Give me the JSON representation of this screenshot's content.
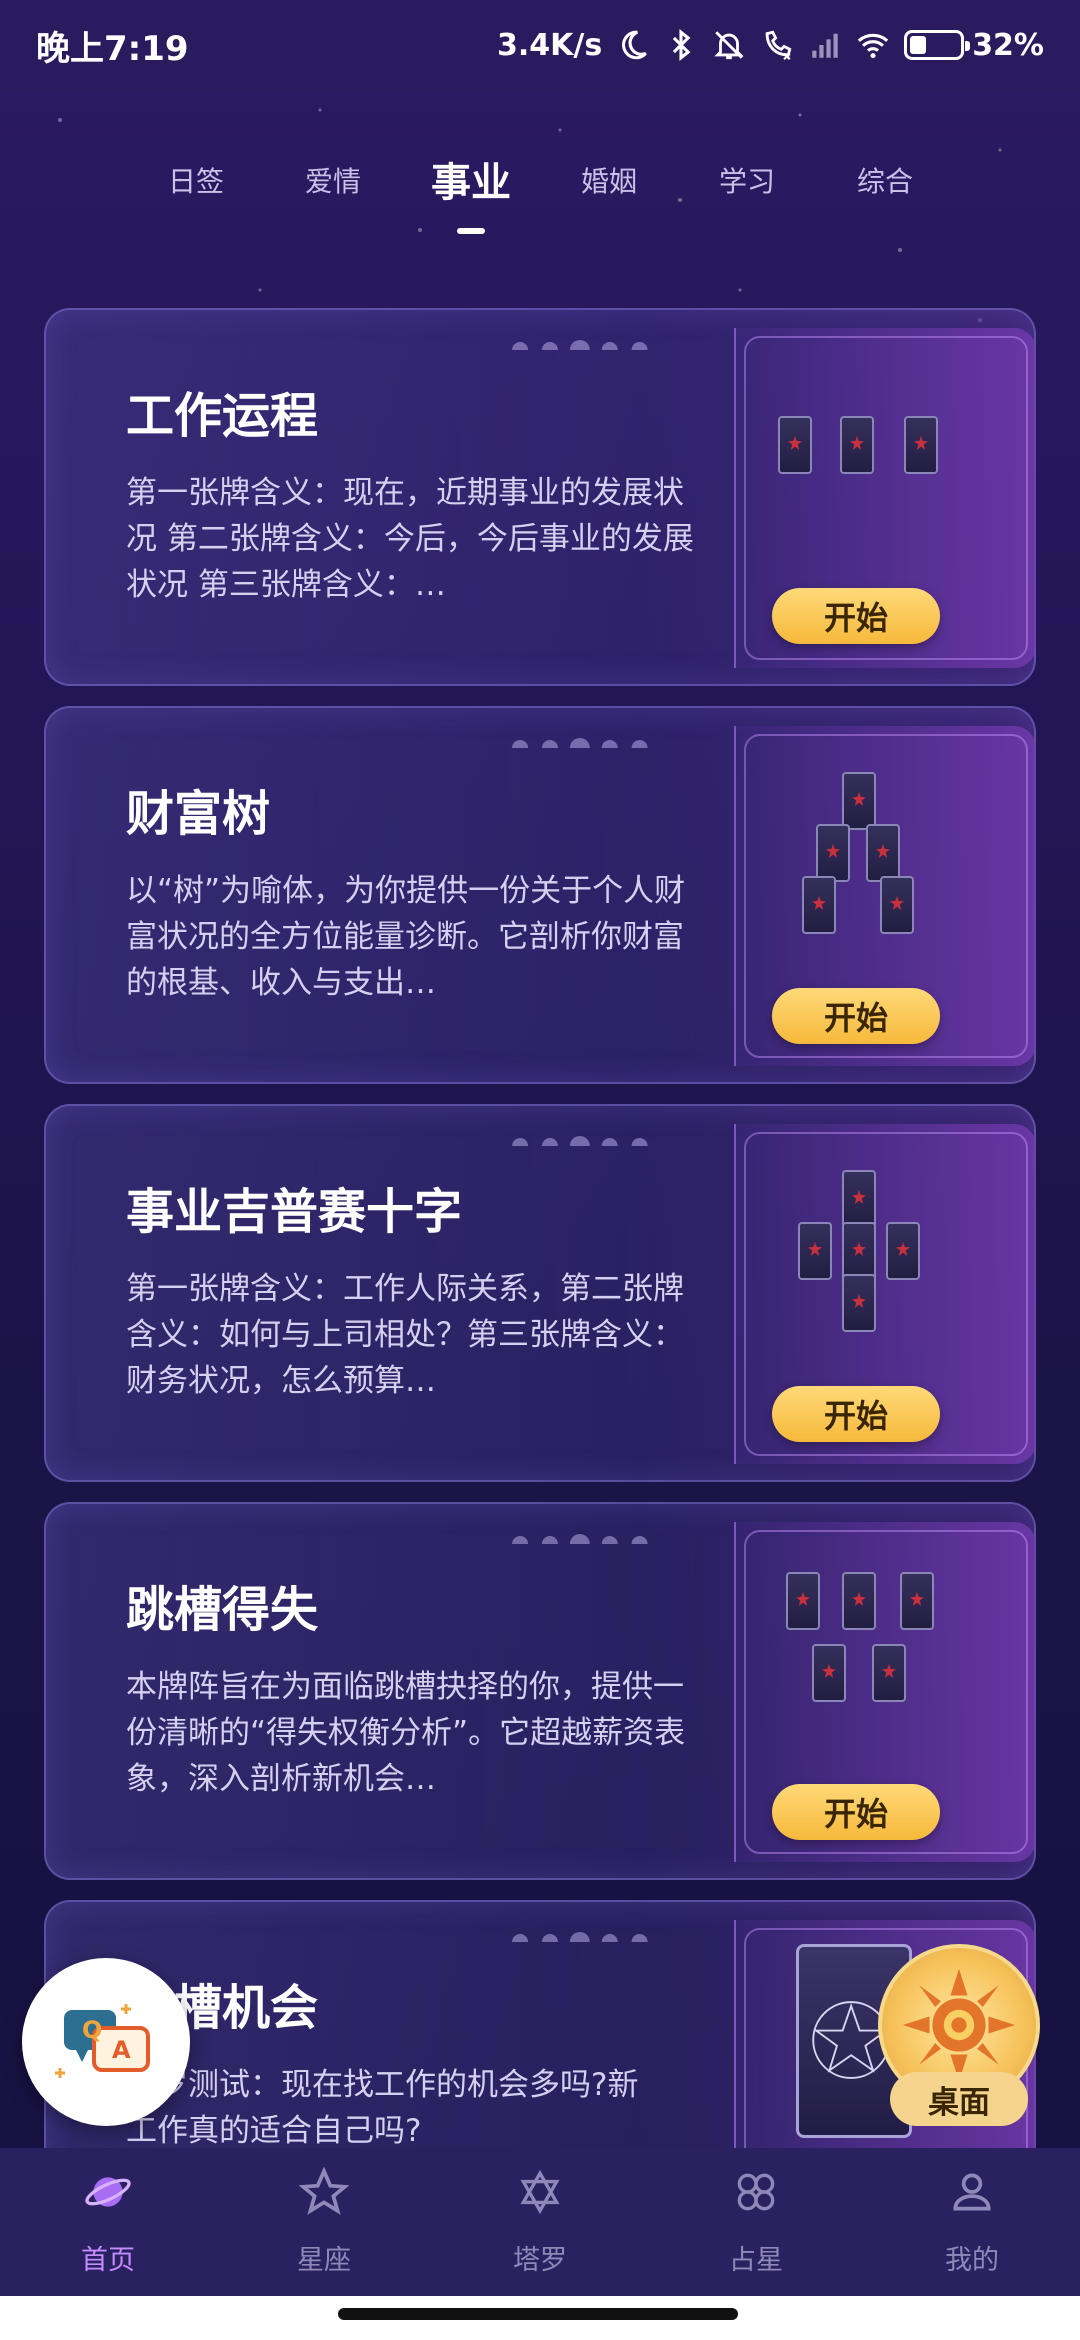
{
  "status_bar": {
    "time": "晚上7:19",
    "speed": "3.4K/s",
    "battery_percent": "32%",
    "battery_level": 0.32,
    "icons": [
      "moon-icon",
      "bluetooth-icon",
      "mute-icon",
      "phone-icon",
      "signal-icon",
      "wifi-icon",
      "battery-icon"
    ]
  },
  "tabs": {
    "items": [
      {
        "label": "日签"
      },
      {
        "label": "爱情"
      },
      {
        "label": "事业"
      },
      {
        "label": "婚姻"
      },
      {
        "label": "学习"
      },
      {
        "label": "综合"
      }
    ],
    "active": "事业"
  },
  "cards": [
    {
      "title": "工作运程",
      "description": "第一张牌含义：现在，近期事业的发展状况 第二张牌含义：今后，今后事业的发展状况 第三张牌含义：…",
      "button": "开始",
      "spread_card_count": 3
    },
    {
      "title": "财富树",
      "description": "以“树”为喻体，为你提供一份关于个人财富状况的全方位能量诊断。它剖析你财富的根基、收入与支出…",
      "button": "开始",
      "spread_card_count": 5
    },
    {
      "title": "事业吉普赛十字",
      "description": "第一张牌含义：工作人际关系，第二张牌含义：如何与上司相处？第三张牌含义：财务状况，怎么预算…",
      "button": "开始",
      "spread_card_count": 5
    },
    {
      "title": "跳槽得失",
      "description": " 本牌阵旨在为面临跳槽抉择的你，提供一份清晰的“得失权衡分析”。它超越薪资表象，深入剖析新机会…",
      "button": "开始",
      "spread_card_count": 5
    },
    {
      "title": "跳槽机会",
      "description": "塔罗测试：现在找工作的机会多吗?新工作真的适合自己吗?",
      "spread_card_count": 1
    }
  ],
  "floating": {
    "qa_letters": [
      "Q",
      "A"
    ],
    "desk_label": "桌面"
  },
  "bottom_nav": {
    "items": [
      {
        "label": "首页",
        "icon": "planet-icon"
      },
      {
        "label": "星座",
        "icon": "star-icon"
      },
      {
        "label": "塔罗",
        "icon": "hexagram-icon"
      },
      {
        "label": "占星",
        "icon": "clover-icon"
      },
      {
        "label": "我的",
        "icon": "user-icon"
      }
    ],
    "active": "首页"
  },
  "colors": {
    "accent": "#c58cff",
    "button": "#f6b93b",
    "background": "#231656"
  }
}
